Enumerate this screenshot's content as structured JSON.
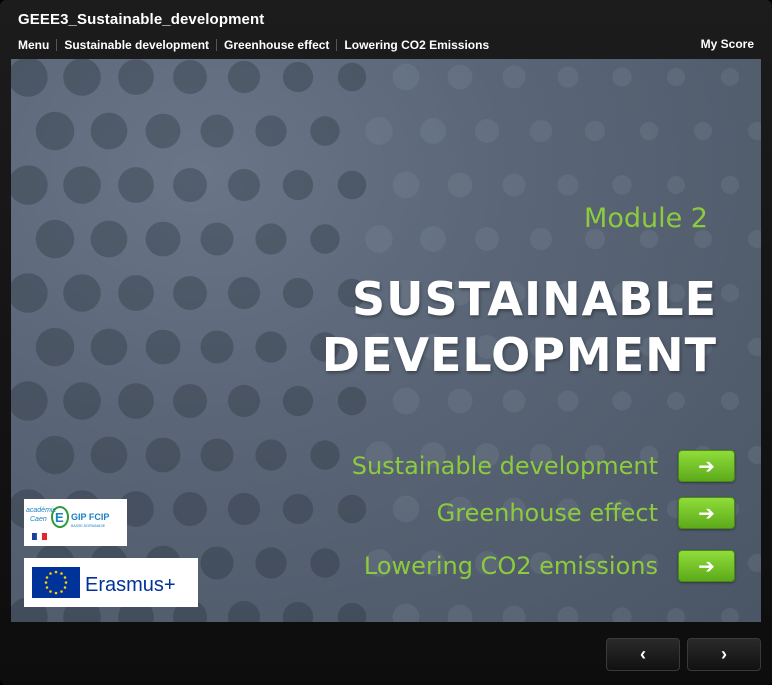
{
  "course": {
    "title": "GEEE3_Sustainable_development"
  },
  "topnav": {
    "items": [
      {
        "label": "Menu"
      },
      {
        "label": "Sustainable development"
      },
      {
        "label": "Greenhouse effect"
      },
      {
        "label": "Lowering CO2 Emissions"
      }
    ],
    "my_score": "My Score"
  },
  "slide": {
    "module_label": "Module 2",
    "title_line1": "SUSTAINABLE",
    "title_line2": "DEVELOPMENT",
    "links": [
      {
        "label": "Sustainable development",
        "button_icon": "arrow-right-icon"
      },
      {
        "label": "Greenhouse effect",
        "button_icon": "arrow-right-icon"
      },
      {
        "label": "Lowering  CO2 emissions",
        "button_icon": "arrow-right-icon"
      }
    ]
  },
  "logos": {
    "academie": {
      "text_academie": "académie",
      "text_caen": "Caen",
      "letter": "E",
      "gip": "GIP FCIP",
      "sub": "BASSE-NORMANDIE"
    },
    "erasmus": {
      "text": "Erasmus+"
    }
  },
  "footer": {
    "prev_icon": "chevron-left-icon",
    "next_icon": "chevron-right-icon",
    "prev_glyph": "‹",
    "next_glyph": "›"
  },
  "colors": {
    "accent_green": "#8ccc3c",
    "button_green": "#6cbf26",
    "slide_bg": "#5a6677",
    "eu_blue": "#003399",
    "eu_yellow": "#ffcc00"
  }
}
